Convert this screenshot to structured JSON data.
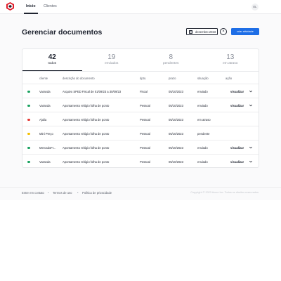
{
  "nav": {
    "tabs": [
      {
        "label": "Início",
        "active": true
      },
      {
        "label": "Clientes",
        "active": false
      }
    ],
    "avatar_initials": "EL"
  },
  "page": {
    "title": "Gerenciar documentos",
    "date_filter": "dezembro 2023",
    "clear_symbol": "×",
    "primary_action": "criar atividade"
  },
  "stats": [
    {
      "value": "42",
      "label": "todos",
      "active": true
    },
    {
      "value": "19",
      "label": "enviados",
      "active": false
    },
    {
      "value": "8",
      "label": "pendentes",
      "active": false
    },
    {
      "value": "13",
      "label": "em atraso",
      "active": false
    }
  ],
  "table": {
    "columns": [
      "cliente",
      "descrição do documento",
      "dpto.",
      "prazo",
      "situação",
      "ação"
    ],
    "rows": [
      {
        "status_color": "#1aa260",
        "client": "Varanda",
        "description": "Arquivo SPED Fiscal de 01/09/23 a 30/09/23",
        "dept": "Fiscal",
        "deadline": "05/10/2023",
        "situation": "enviado",
        "action": "visualizar"
      },
      {
        "status_color": "#1aa260",
        "client": "Varanda",
        "description": "Apontamento relógio folha de ponto",
        "dept": "Pessoal",
        "deadline": "05/10/2023",
        "situation": "enviado",
        "action": "visualizar"
      },
      {
        "status_color": "#e53935",
        "client": "Ajulia",
        "description": "Apontamento relógio folha de ponto",
        "dept": "Pessoal",
        "deadline": "05/10/2023",
        "situation": "em atraso",
        "action": ""
      },
      {
        "status_color": "#f5c000",
        "client": "Mini Preço",
        "description": "Apontamento relógio folha de ponto",
        "dept": "Pessoal",
        "deadline": "05/10/2023",
        "situation": "pendente",
        "action": ""
      },
      {
        "status_color": "#1aa260",
        "client": "MercadoFr...",
        "description": "Apontamento relógio folha de ponto",
        "dept": "Pessoal",
        "deadline": "05/10/2023",
        "situation": "enviado",
        "action": "visualizar"
      },
      {
        "status_color": "#1aa260",
        "client": "Varanda",
        "description": "Apontamento relógio folha de ponto",
        "dept": "Pessoal",
        "deadline": "05/10/2023",
        "situation": "enviado",
        "action": "visualizar"
      }
    ]
  },
  "footer": {
    "links": [
      "Entre em contato",
      "Termos de uso",
      "Política de privacidade"
    ],
    "separator": "•",
    "copyright": "Copyright © 2023 Acme Inc. Todos os direitos reservados."
  }
}
